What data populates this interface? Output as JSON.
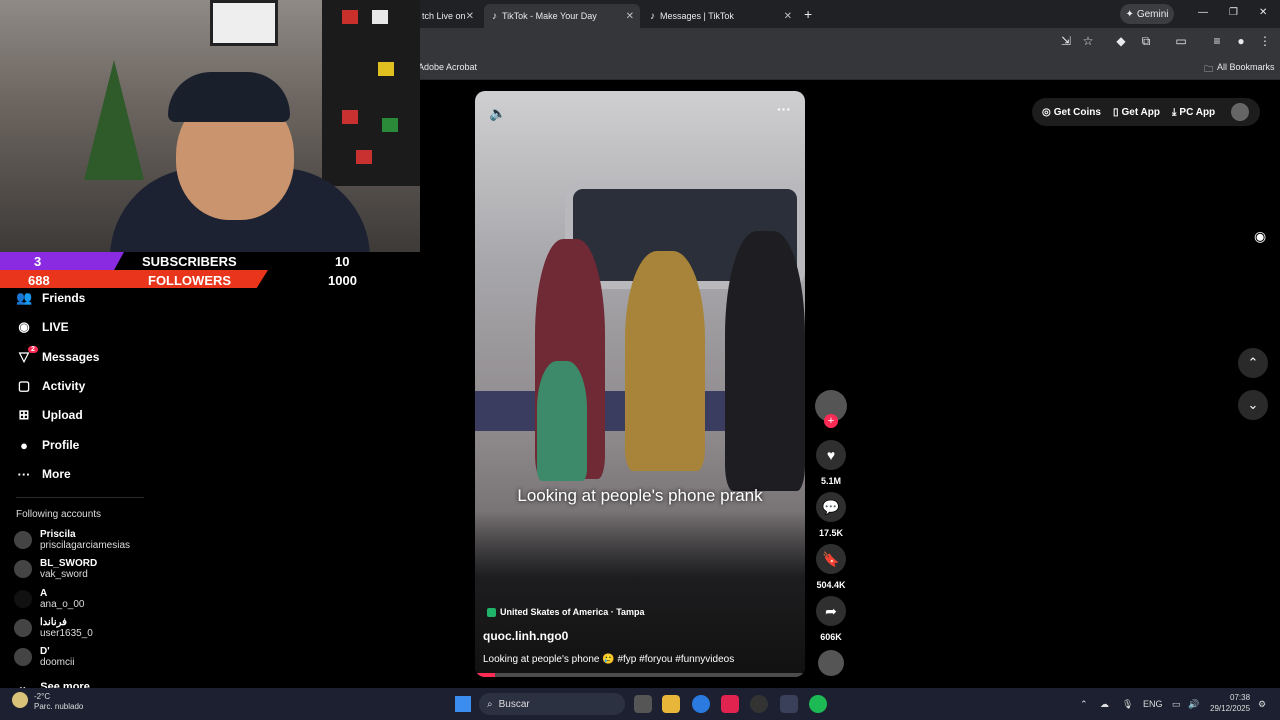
{
  "browser": {
    "tabs": [
      {
        "label": "tch Live on"
      },
      {
        "label": "TikTok - Make Your Day"
      },
      {
        "label": "Messages | TikTok"
      }
    ],
    "gemini_label": "Gemini",
    "bookmark_adobe": "Adobe Acrobat",
    "bookmark_all": "All Bookmarks"
  },
  "overlay": {
    "subs_count": "3",
    "subs_label": "SUBSCRIBERS",
    "subs_goal": "10",
    "followers_count": "688",
    "followers_label": "FOLLOWERS",
    "followers_goal": "1000"
  },
  "sidebar": {
    "items": [
      {
        "label": "Friends"
      },
      {
        "label": "LIVE"
      },
      {
        "label": "Messages",
        "badge": "2"
      },
      {
        "label": "Activity"
      },
      {
        "label": "Upload"
      },
      {
        "label": "Profile"
      },
      {
        "label": "More"
      }
    ],
    "following_title": "Following accounts",
    "accounts": [
      {
        "name": "Priscila",
        "handle": "priscilagarciamesias"
      },
      {
        "name": "BL_SWORD",
        "handle": "vak_sword"
      },
      {
        "name": "A",
        "handle": "ana_o_00"
      },
      {
        "name": "فرناندا",
        "handle": "user1635_0"
      },
      {
        "name": "D'",
        "handle": "doomcii"
      }
    ],
    "see_more": "See more"
  },
  "video": {
    "caption": "Looking at people's phone prank",
    "location": "United Skates of America · Tampa",
    "author": "quoc.linh.ngo0",
    "description": "Looking at people's phone 🥲 #fyp #foryou #funnyvideos",
    "progress": 0.06
  },
  "actions": {
    "likes": "5.1M",
    "comments": "17.5K",
    "saves": "504.4K",
    "shares": "606K"
  },
  "topright": {
    "coins": "Get Coins",
    "app": "Get App",
    "pc": "PC App"
  },
  "taskbar": {
    "temp": "-2°C",
    "weather": "Parc. nublado",
    "search": "Buscar",
    "lang": "ENG",
    "time": "07:38",
    "date": "29/12/2025"
  }
}
